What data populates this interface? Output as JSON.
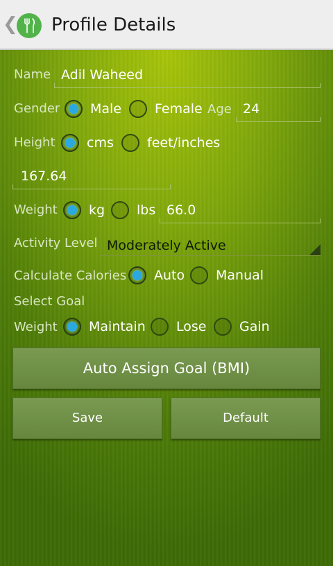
{
  "header": {
    "title": "Profile Details",
    "back_glyph": "❮",
    "app_icon": "fork-knife-icon"
  },
  "profile": {
    "name_label": "Name",
    "name_value": "Adil Waheed",
    "gender_label": "Gender",
    "gender_options": [
      "Male",
      "Female"
    ],
    "gender_selected": "Male",
    "age_label": "Age",
    "age_value": "24",
    "height_label": "Height",
    "height_units": [
      "cms",
      "feet/inches"
    ],
    "height_unit_selected": "cms",
    "height_value": "167.64",
    "weight_label": "Weight",
    "weight_units": [
      "kg",
      "lbs"
    ],
    "weight_unit_selected": "kg",
    "weight_value": "66.0",
    "activity_label": "Activity Level",
    "activity_value": "Moderately Active",
    "calories_label": "Calculate Calories",
    "calories_options": [
      "Auto",
      "Manual"
    ],
    "calories_selected": "Auto",
    "select_goal_label": "Select Goal",
    "goal_weight_label": "Weight",
    "goal_options": [
      "Maintain",
      "Lose",
      "Gain"
    ],
    "goal_selected": "Maintain"
  },
  "buttons": {
    "auto_assign": "Auto Assign Goal (BMI)",
    "save": "Save",
    "default": "Default"
  },
  "colors": {
    "accent_radio": "#2aa8e0",
    "background": "#7fa70b",
    "actionbar": "#eeeeee"
  }
}
